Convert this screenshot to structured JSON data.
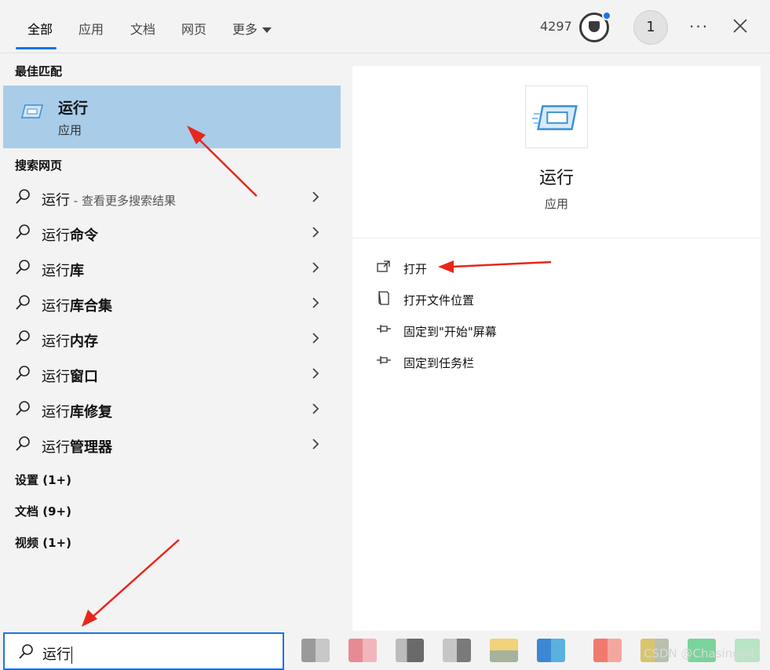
{
  "topbar": {
    "tabs": [
      {
        "label": "全部"
      },
      {
        "label": "应用"
      },
      {
        "label": "文档"
      },
      {
        "label": "网页"
      },
      {
        "label": "更多"
      }
    ],
    "points": "4297",
    "avatar_initial": "1",
    "more_options": "···"
  },
  "left": {
    "best_match_heading": "最佳匹配",
    "best_match": {
      "title": "运行",
      "subtitle": "应用",
      "icon": "run-app-icon"
    },
    "web_heading": "搜索网页",
    "web_results": [
      {
        "prefix": "运行",
        "bold": "",
        "hint": " - 查看更多搜索结果"
      },
      {
        "prefix": "运行",
        "bold": "命令",
        "hint": ""
      },
      {
        "prefix": "运行",
        "bold": "库",
        "hint": ""
      },
      {
        "prefix": "运行",
        "bold": "库合集",
        "hint": ""
      },
      {
        "prefix": "运行",
        "bold": "内存",
        "hint": ""
      },
      {
        "prefix": "运行",
        "bold": "窗口",
        "hint": ""
      },
      {
        "prefix": "运行",
        "bold": "库修复",
        "hint": ""
      },
      {
        "prefix": "运行",
        "bold": "管理器",
        "hint": ""
      }
    ],
    "categories": [
      {
        "label": "设置 (1+)"
      },
      {
        "label": "文档 (9+)"
      },
      {
        "label": "视频 (1+)"
      }
    ]
  },
  "right": {
    "app_title": "运行",
    "app_subtitle": "应用",
    "actions": [
      {
        "label": "打开",
        "icon": "open-icon"
      },
      {
        "label": "打开文件位置",
        "icon": "file-location-icon"
      },
      {
        "label": "固定到\"开始\"屏幕",
        "icon": "pin-icon"
      },
      {
        "label": "固定到任务栏",
        "icon": "pin-icon"
      }
    ]
  },
  "searchbox": {
    "value": "运行"
  },
  "watermark": "CSDN @Chasingyq",
  "colors": {
    "accent": "#1a73e8",
    "selected_row": "#a9cce9",
    "arrow": "#e8261c",
    "panel_bg": "#f3f3f3"
  }
}
